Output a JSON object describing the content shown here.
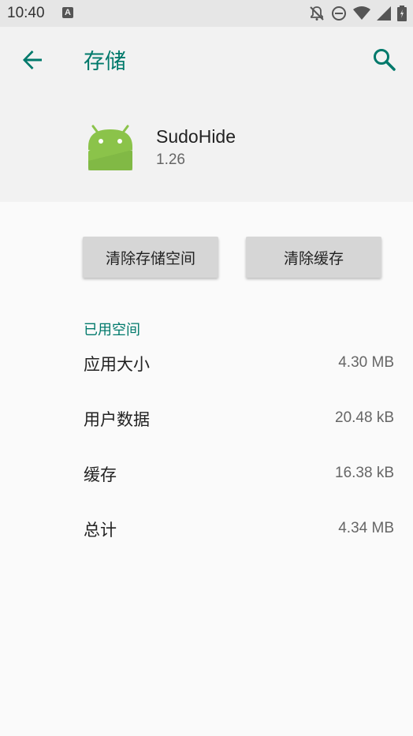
{
  "status_bar": {
    "time": "10:40",
    "notification_badge": "A",
    "icons": [
      "notifications-off-icon",
      "do-not-disturb-icon",
      "wifi-icon",
      "signal-icon",
      "battery-icon"
    ]
  },
  "app_bar": {
    "back_icon": "arrow-back-icon",
    "title": "存储",
    "search_icon": "search-icon",
    "accent_color": "#00796b"
  },
  "app_info": {
    "icon": "android-icon",
    "name": "SudoHide",
    "version": "1.26"
  },
  "actions": {
    "clear_storage": "清除存储空间",
    "clear_cache": "清除缓存"
  },
  "space_used": {
    "title": "已用空间",
    "rows": [
      {
        "label": "应用大小",
        "value": "4.30 MB"
      },
      {
        "label": "用户数据",
        "value": "20.48 kB"
      },
      {
        "label": "缓存",
        "value": "16.38 kB"
      },
      {
        "label": "总计",
        "value": "4.34 MB"
      }
    ]
  }
}
